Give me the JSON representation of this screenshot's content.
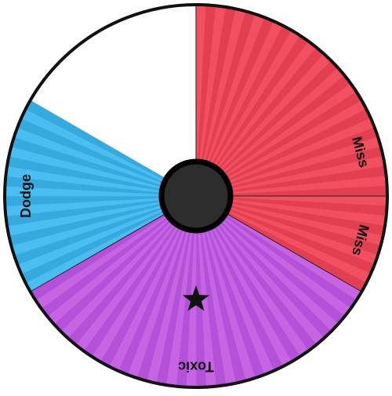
{
  "wheel": {
    "segments": [
      {
        "label": "Miss",
        "start_deg": -90,
        "sweep_deg": 150,
        "color": "#f0505f",
        "color_alt": "#e24050",
        "icon": ""
      },
      {
        "label": "Miss",
        "start_deg": 0,
        "sweep_deg": 30,
        "color": "#f0505f",
        "color_alt": "#e24050",
        "icon": ""
      },
      {
        "label": "Toxic",
        "start_deg": 30,
        "sweep_deg": 120,
        "color": "#c565e4",
        "color_alt": "#b352d8",
        "icon": "star-icon"
      },
      {
        "label": "Dodge",
        "start_deg": 150,
        "sweep_deg": 60,
        "color": "#4bbef1",
        "color_alt": "#36a9de",
        "icon": ""
      }
    ],
    "outline_color": "#111111",
    "hub_color": "#2d2d2d",
    "hub_ring_color": "#000000"
  }
}
